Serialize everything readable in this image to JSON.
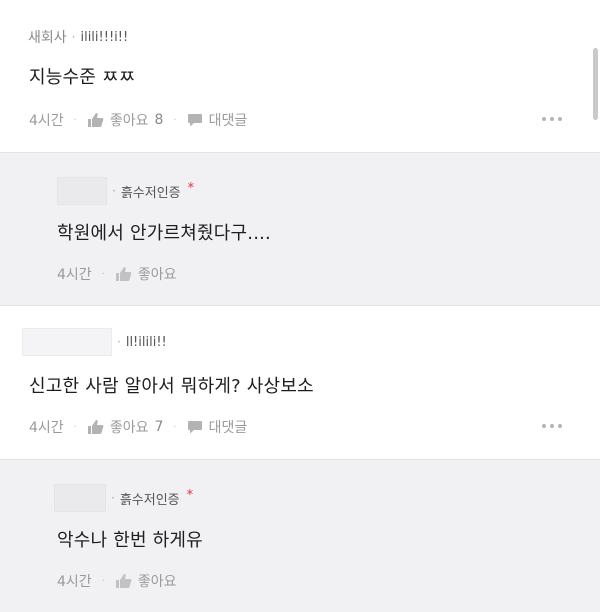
{
  "comments": [
    {
      "author": "새회사",
      "tag": "ilili!!!i!!",
      "text": "지능수준 ㅉㅉ",
      "time": "4시간",
      "like_label": "좋아요",
      "like_count": "8",
      "reply_label": "대댓글"
    },
    {
      "tag": "흙수저인증",
      "badge": "*",
      "text": "학원에서 안가르쳐줬다구....",
      "time": "4시간",
      "like_label": "좋아요"
    },
    {
      "tag": "ll!ilili!!",
      "text": "신고한 사람 알아서 뭐하게? 사상보소",
      "time": "4시간",
      "like_label": "좋아요",
      "like_count": "7",
      "reply_label": "대댓글"
    },
    {
      "tag": "흙수저인증",
      "badge": "*",
      "text": "악수나 한번 하게유",
      "time": "4시간",
      "like_label": "좋아요"
    }
  ],
  "icons": {
    "like": "thumbs-up-icon",
    "reply": "speech-bubble-icon",
    "more": "more-dots-icon"
  },
  "colors": {
    "badge": "#e0353b",
    "reply_background": "#f1f1f3",
    "muted_text": "#8a8a8a"
  }
}
